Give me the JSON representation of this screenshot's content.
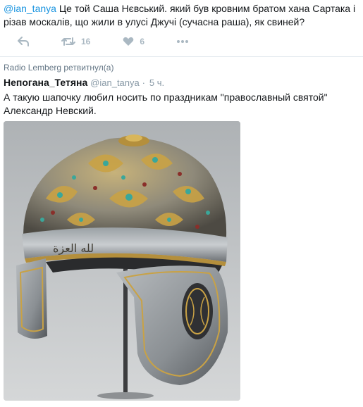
{
  "reply": {
    "mention": "@ian_tanya",
    "text": " Це той Саша Нєвський. який був кровним братом хана Сартака і різав москалів, що жили в улусі Джучі (сучасна раша), як  свиней?"
  },
  "actions": {
    "retweet_count": "16",
    "like_count": "6"
  },
  "retweet_header": "Radio Lemberg ретвитнул(а)",
  "retweeted": {
    "display_name": "Непогана_Тетяна",
    "handle": "@ian_tanya",
    "separator": "·",
    "time": "5 ч.",
    "text": "А такую шапочку любил носить по праздникам \"православный святой\" Александр Невский."
  },
  "photo": {
    "description_icon": "helmet-photo",
    "inscription": "ﻟﻠﻪ ﺍﻟﻌﺰﺓ",
    "colors": {
      "steel": "#8f9296",
      "gold": "#c9a245",
      "turquoise": "#3aa79a"
    }
  },
  "colors": {
    "link": "#1b95e0",
    "muted": "#8899a6",
    "border": "#e1e8ed"
  }
}
